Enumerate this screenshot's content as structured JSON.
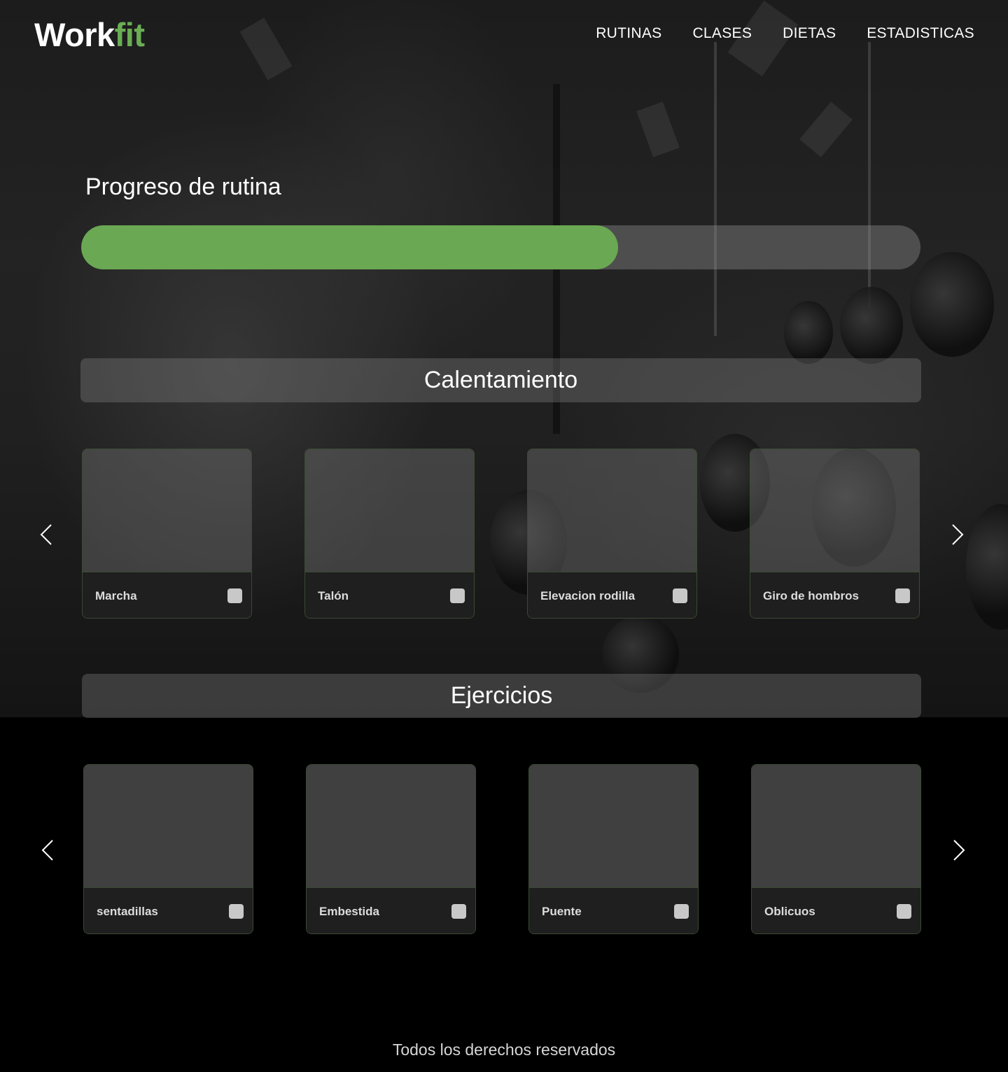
{
  "brand": {
    "name_main": "Work",
    "name_accent": "fit",
    "accent_color": "#6aad55"
  },
  "nav": {
    "items": [
      {
        "label": "RUTINAS"
      },
      {
        "label": "CLASES"
      },
      {
        "label": "DIETAS"
      },
      {
        "label": "ESTADISTICAS"
      }
    ]
  },
  "progress": {
    "title": "Progreso de rutina",
    "fraction": 0.64,
    "fill_color": "#6aa853"
  },
  "warmup": {
    "title": "Calentamiento",
    "cards": [
      {
        "label": "Marcha",
        "checked": false
      },
      {
        "label": "Talón",
        "checked": false
      },
      {
        "label": "Elevacion rodilla",
        "checked": false
      },
      {
        "label": "Giro de hombros",
        "checked": false
      }
    ],
    "prev_icon": "chevron-left-icon",
    "next_icon": "chevron-right-icon"
  },
  "exercises": {
    "title": "Ejercicios",
    "cards": [
      {
        "label": "sentadillas",
        "checked": false
      },
      {
        "label": "Embestida",
        "checked": false
      },
      {
        "label": "Puente",
        "checked": false
      },
      {
        "label": "Oblicuos",
        "checked": false
      }
    ],
    "prev_icon": "chevron-left-icon",
    "next_icon": "chevron-right-icon"
  },
  "footer": {
    "text": "Todos los derechos reservados"
  }
}
